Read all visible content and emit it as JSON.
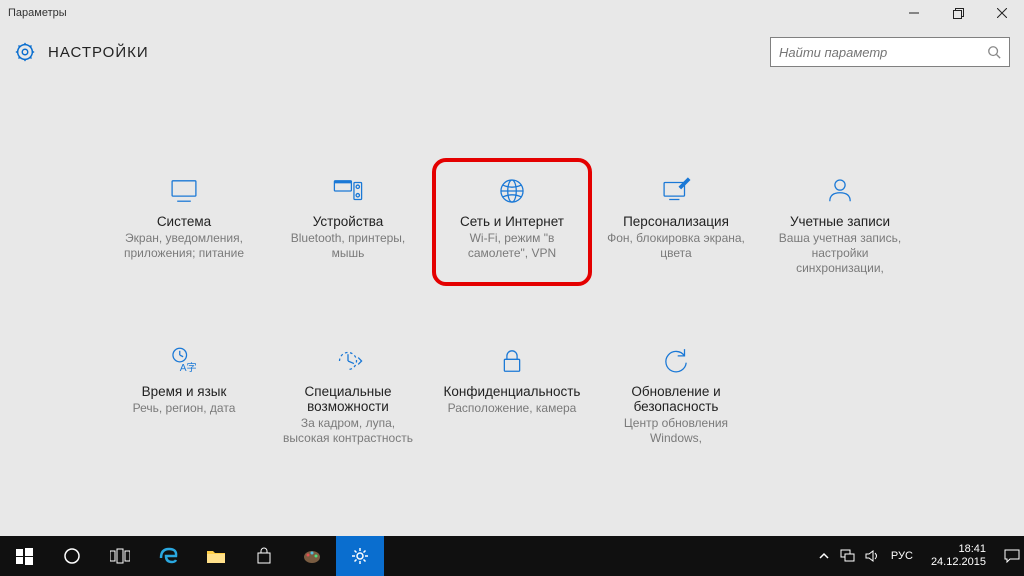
{
  "window": {
    "title": "Параметры"
  },
  "header": {
    "title": "НАСТРОЙКИ"
  },
  "search": {
    "placeholder": "Найти параметр"
  },
  "tiles": [
    {
      "name": "Система",
      "desc": "Экран, уведомления, приложения; питание"
    },
    {
      "name": "Устройства",
      "desc": "Bluetooth, принтеры, мышь"
    },
    {
      "name": "Сеть и Интернет",
      "desc": "Wi-Fi, режим \"в самолете\", VPN"
    },
    {
      "name": "Персонализация",
      "desc": "Фон, блокировка экрана, цвета"
    },
    {
      "name": "Учетные записи",
      "desc": "Ваша учетная запись, настройки синхронизации,"
    },
    {
      "name": "Время и язык",
      "desc": "Речь, регион, дата"
    },
    {
      "name": "Специальные возможности",
      "desc": "За кадром, лупа, высокая контрастность"
    },
    {
      "name": "Конфиденциальность",
      "desc": "Расположение, камера"
    },
    {
      "name": "Обновление и безопасность",
      "desc": "Центр обновления Windows,"
    }
  ],
  "taskbar": {
    "lang": "РУС",
    "time": "18:41",
    "date": "24.12.2015"
  },
  "colors": {
    "accent": "#1a78d6",
    "highlight": "#e40000"
  }
}
